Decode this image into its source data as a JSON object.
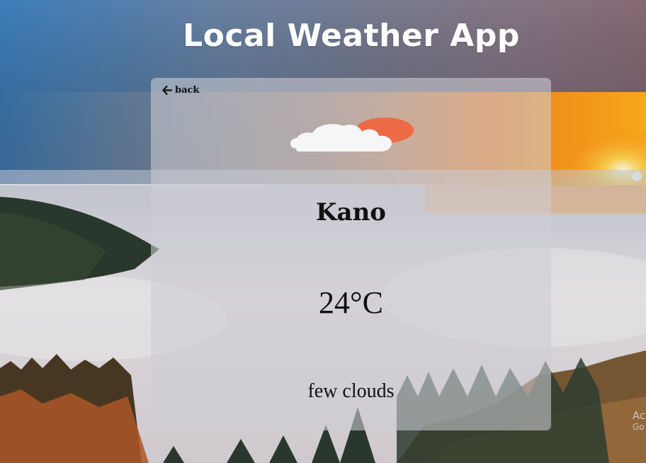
{
  "app": {
    "title": "Local Weather App"
  },
  "card": {
    "back_label": "back",
    "back_icon": "arrow-left-icon",
    "weather_icon": "few-clouds-day-icon",
    "city": "Kano",
    "temperature": "24°C",
    "description": "few clouds"
  },
  "watermark": {
    "line1": "Ac",
    "line2": "Go"
  },
  "colors": {
    "title_text": "#ffffff",
    "card_background": "rgba(205,205,212,0.58)",
    "sun": "#ec6a45",
    "cloud": "#f5f5f5",
    "card_text": "#111111"
  }
}
